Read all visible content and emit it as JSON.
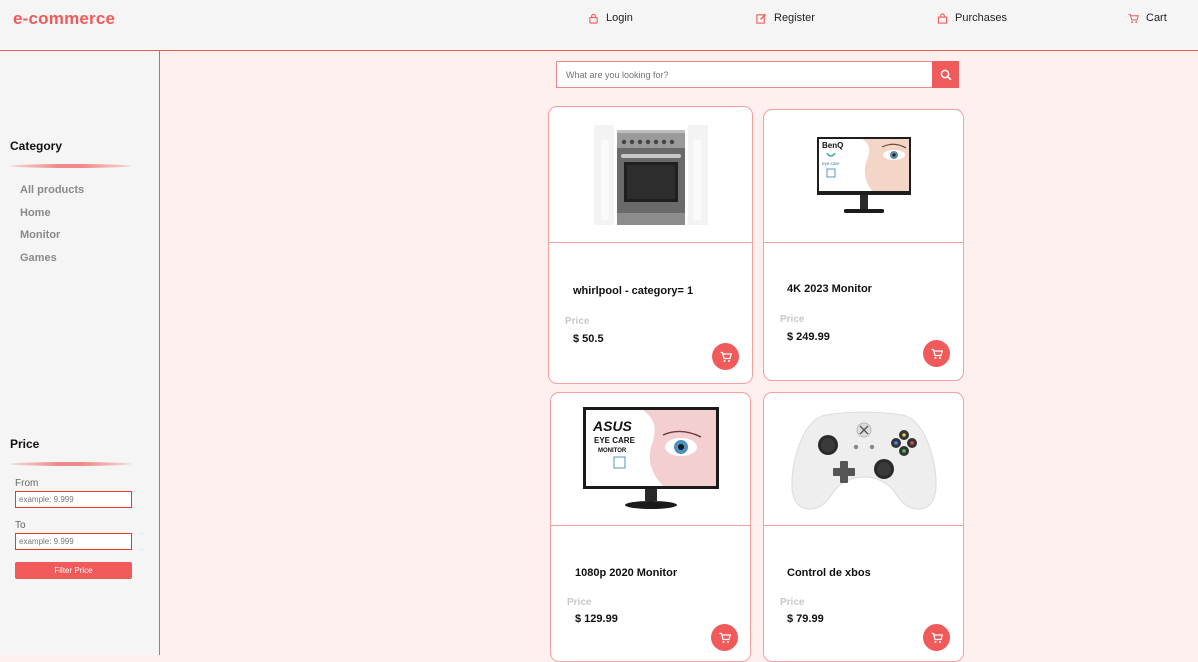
{
  "header": {
    "brand": "e-commerce",
    "nav": [
      {
        "label": "Login",
        "icon": "lock-icon"
      },
      {
        "label": "Register",
        "icon": "edit-icon"
      },
      {
        "label": "Purchases",
        "icon": "bag-icon"
      },
      {
        "label": "Cart",
        "icon": "cart-icon"
      }
    ]
  },
  "sidebar": {
    "category_title": "Category",
    "categories": [
      "All products",
      "Home",
      "Monitor",
      "Games"
    ],
    "price_title": "Price",
    "from_label": "From",
    "to_label": "To",
    "from_placeholder": "example: 9.999",
    "to_placeholder": "example: 9.999",
    "filter_label": "Filter Price"
  },
  "search": {
    "placeholder": "What are you looking for?"
  },
  "products": [
    {
      "name": "whirlpool - category= 1",
      "price_label": "Price",
      "price": "$ 50.5",
      "image": "stove"
    },
    {
      "name": "4K 2023 Monitor",
      "price_label": "Price",
      "price": "$ 249.99",
      "image": "benq-monitor"
    },
    {
      "name": "1080p 2020 Monitor",
      "price_label": "Price",
      "price": "$ 129.99",
      "image": "asus-monitor"
    },
    {
      "name": "Control de xbos",
      "price_label": "Price",
      "price": "$ 79.99",
      "image": "xbox-controller"
    }
  ],
  "image_text": {
    "benq_brand": "BenQ",
    "benq_caption": "eye-care",
    "asus_brand": "ASUS",
    "asus_line1": "EYE CARE",
    "asus_line2": "MONITOR"
  },
  "colors": {
    "accent": "#f05a5a",
    "page_bg": "#fff0f0",
    "sidebar_bg": "#f5f5f5"
  }
}
